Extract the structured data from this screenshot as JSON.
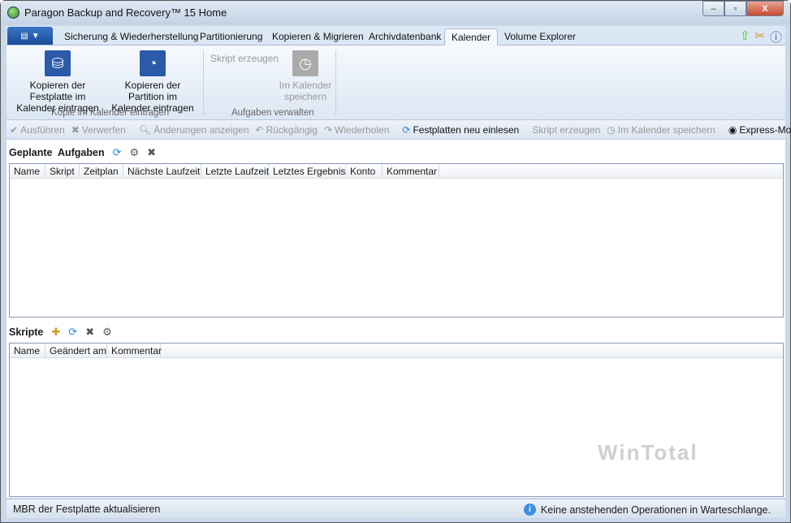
{
  "window": {
    "title": "Paragon Backup and Recovery™ 15 Home",
    "minimize": "–",
    "maximize": "▫",
    "close": "X"
  },
  "tabs": [
    {
      "label": "Sicherung & Wiederherstellung"
    },
    {
      "label": "Partitionierung"
    },
    {
      "label": "Kopieren & Migrieren"
    },
    {
      "label": "Archivdatenbank"
    },
    {
      "label": "Kalender",
      "active": true
    },
    {
      "label": "Volume Explorer"
    }
  ],
  "ribbon": {
    "copy_disk": "Kopieren der Festplatte im Kalender eintragen",
    "copy_partition": "Kopieren der Partition im Kalender eintragen",
    "group1": "Kopie im Kalender eintragen",
    "create_script": "Skript erzeugen",
    "save_calendar": "Im Kalender speichern",
    "group2": "Aufgaben verwalten"
  },
  "toolbar": {
    "apply": "Ausführen",
    "discard": "Verwerfen",
    "show_changes": "Änderungen anzeigen",
    "undo": "Rückgängig",
    "redo": "Wiederholen",
    "rescan": "Festplatten neu einlesen",
    "create_script": "Skript erzeugen",
    "save_calendar": "Im Kalender speichern",
    "express": "Express-Modus"
  },
  "tasks": {
    "title": "Geplante  Aufgaben",
    "columns": [
      "Name",
      "Skript",
      "Zeitplan",
      "Nächste Laufzeit",
      "Letzte Laufzeit",
      "Letztes Ergebnis",
      "Konto",
      "Kommentar"
    ],
    "rows": []
  },
  "scripts": {
    "title": "Skripte",
    "columns": [
      "Name",
      "Geändert am",
      "Kommentar"
    ],
    "rows": []
  },
  "watermark": "WinTotal",
  "status": {
    "left": "MBR der Festplatte aktualisieren",
    "right": "Keine anstehenden Operationen in Warteschlange.",
    "info_icon": "i"
  },
  "colors": {
    "accent": "#2a5aa8",
    "titlebar": "#c9d8ea"
  }
}
